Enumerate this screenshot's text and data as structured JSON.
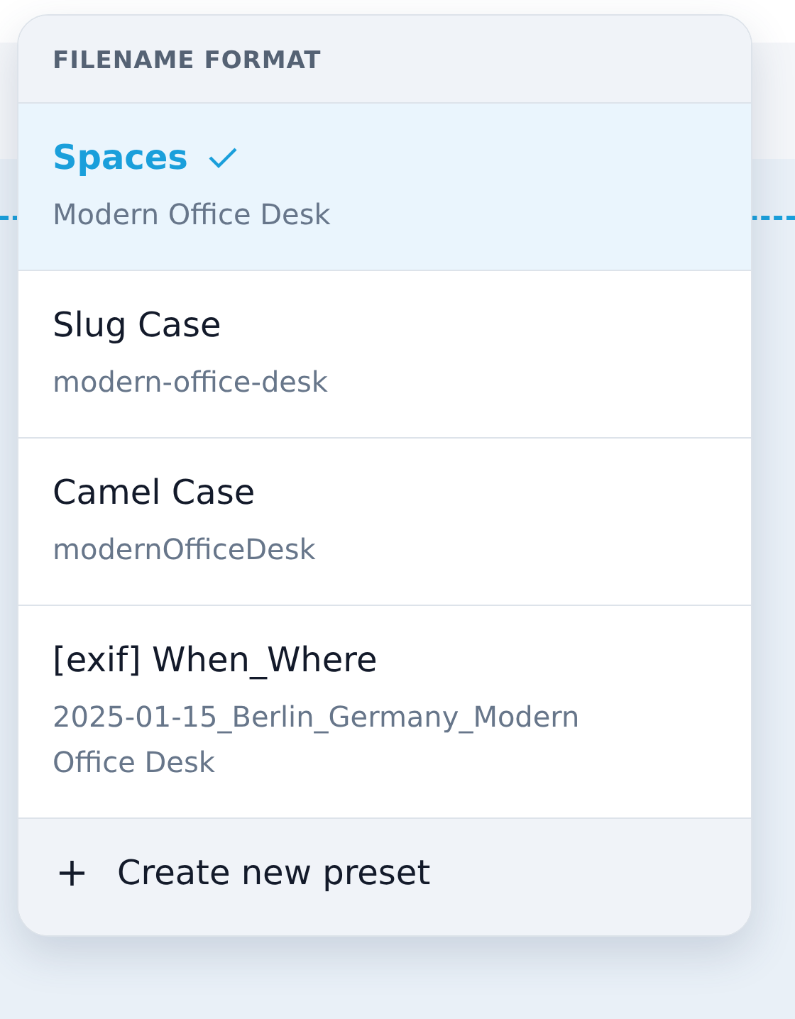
{
  "menu": {
    "title": "FILENAME FORMAT",
    "options": [
      {
        "name": "Spaces",
        "example": "Modern Office Desk",
        "selected": true
      },
      {
        "name": "Slug Case",
        "example": "modern-office-desk",
        "selected": false
      },
      {
        "name": "Camel Case",
        "example": "modernOfficeDesk",
        "selected": false
      },
      {
        "name": "[exif] When_Where",
        "example": "2025-01-15_Berlin_Germany_Modern Office Desk",
        "selected": false
      }
    ],
    "footer_action": {
      "icon": "+",
      "label": "Create new preset"
    }
  }
}
